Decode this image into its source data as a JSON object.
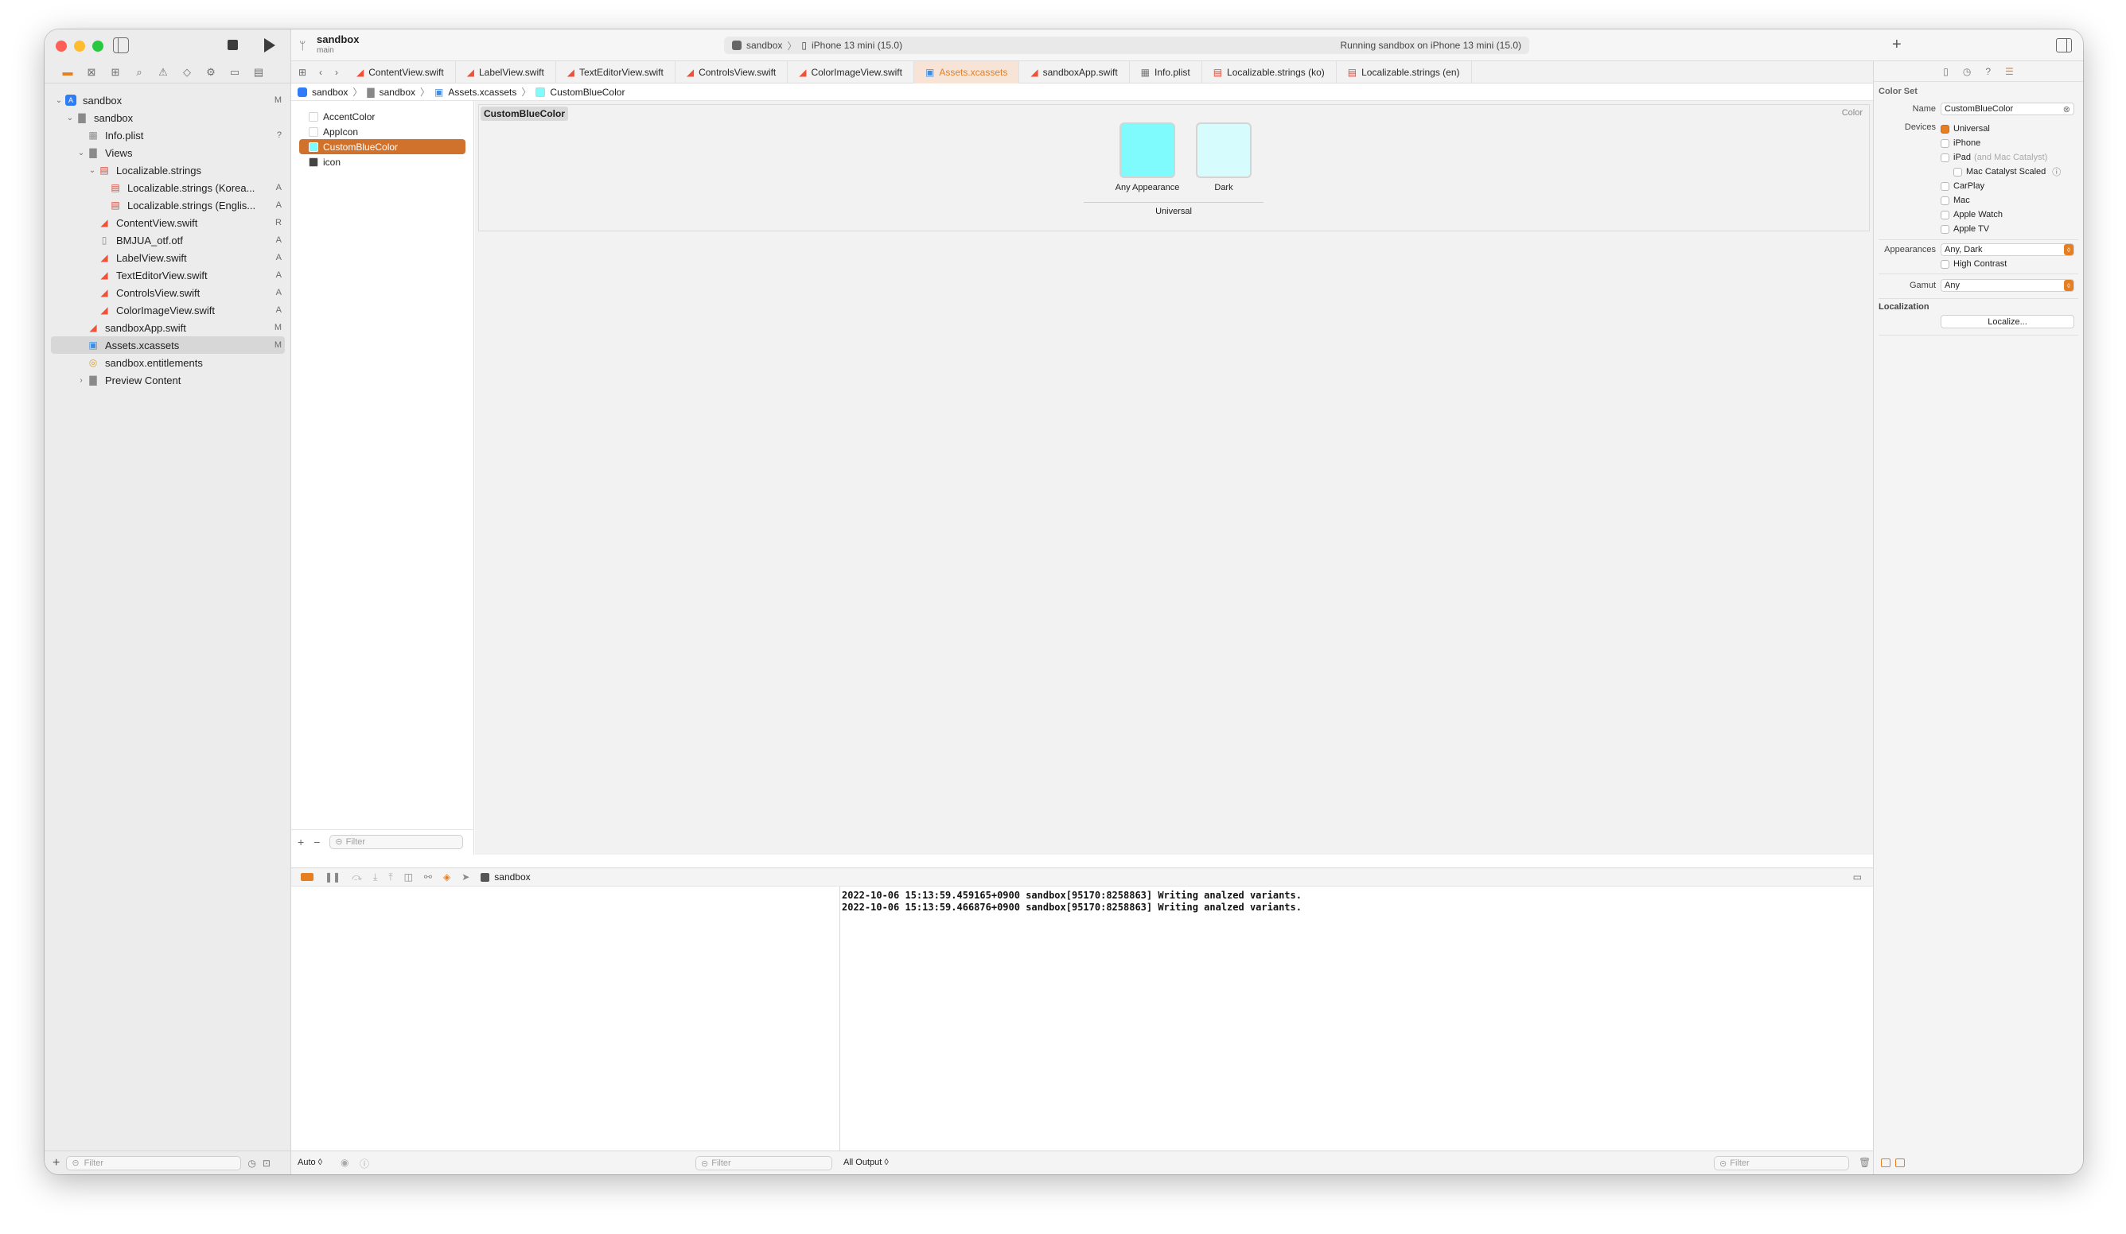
{
  "window": {
    "project_name": "sandbox",
    "branch": "main",
    "activity_scheme": "sandbox",
    "activity_device": "iPhone 13 mini (15.0)",
    "status": "Running sandbox on iPhone 13 mini (15.0)"
  },
  "navigator": {
    "items": [
      {
        "label": "sandbox",
        "badge": "M"
      },
      {
        "label": "sandbox",
        "badge": ""
      },
      {
        "label": "Info.plist",
        "badge": "?"
      },
      {
        "label": "Views",
        "badge": ""
      },
      {
        "label": "Localizable.strings",
        "badge": ""
      },
      {
        "label": "Localizable.strings (Korea...",
        "badge": "A"
      },
      {
        "label": "Localizable.strings (Englis...",
        "badge": "A"
      },
      {
        "label": "ContentView.swift",
        "badge": "R"
      },
      {
        "label": "BMJUA_otf.otf",
        "badge": "A"
      },
      {
        "label": "LabelView.swift",
        "badge": "A"
      },
      {
        "label": "TextEditorView.swift",
        "badge": "A"
      },
      {
        "label": "ControlsView.swift",
        "badge": "A"
      },
      {
        "label": "ColorImageView.swift",
        "badge": "A"
      },
      {
        "label": "sandboxApp.swift",
        "badge": "M"
      },
      {
        "label": "Assets.xcassets",
        "badge": "M"
      },
      {
        "label": "sandbox.entitlements",
        "badge": ""
      },
      {
        "label": "Preview Content",
        "badge": ""
      }
    ],
    "filter_placeholder": "Filter"
  },
  "tabs": [
    "ContentView.swift",
    "LabelView.swift",
    "TextEditorView.swift",
    "ControlsView.swift",
    "ColorImageView.swift",
    "Assets.xcassets",
    "sandboxApp.swift",
    "Info.plist",
    "Localizable.strings (ko)",
    "Localizable.strings (en)"
  ],
  "breadcrumb": [
    "sandbox",
    "sandbox",
    "Assets.xcassets",
    "CustomBlueColor"
  ],
  "assets": {
    "items": [
      "AccentColor",
      "AppIcon",
      "CustomBlueColor",
      "icon"
    ],
    "filter_placeholder": "Filter"
  },
  "editor": {
    "title": "CustomBlueColor",
    "kind": "Color",
    "swatch_any_label": "Any Appearance",
    "swatch_dark_label": "Dark",
    "group_label": "Universal",
    "any_color": "#7ffbfd",
    "dark_color": "#d6fcfd"
  },
  "inspector": {
    "section": "Color Set",
    "name_label": "Name",
    "name_value": "CustomBlueColor",
    "devices_label": "Devices",
    "devices": [
      {
        "label": "Universal",
        "checked": true
      },
      {
        "label": "iPhone",
        "checked": false
      },
      {
        "label": "iPad",
        "checked": false
      },
      {
        "label": "Mac Catalyst Scaled",
        "checked": false
      },
      {
        "label": "CarPlay",
        "checked": false
      },
      {
        "label": "Mac",
        "checked": false
      },
      {
        "label": "Apple Watch",
        "checked": false
      },
      {
        "label": "Apple TV",
        "checked": false
      }
    ],
    "ipad_note": "(and Mac Catalyst)",
    "appearances_label": "Appearances",
    "appearances_value": "Any, Dark",
    "high_contrast": "High Contrast",
    "gamut_label": "Gamut",
    "gamut_value": "Any",
    "localization_label": "Localization",
    "localize_button": "Localize..."
  },
  "debug": {
    "target": "sandbox",
    "console_lines": [
      "2022-10-06 15:13:59.459165+0900 sandbox[95170:8258863] Writing analzed variants.",
      "2022-10-06 15:13:59.466876+0900 sandbox[95170:8258863] Writing analzed variants."
    ],
    "auto_label": "Auto ◊",
    "output_label": "All Output ◊",
    "filter_placeholder": "Filter"
  }
}
